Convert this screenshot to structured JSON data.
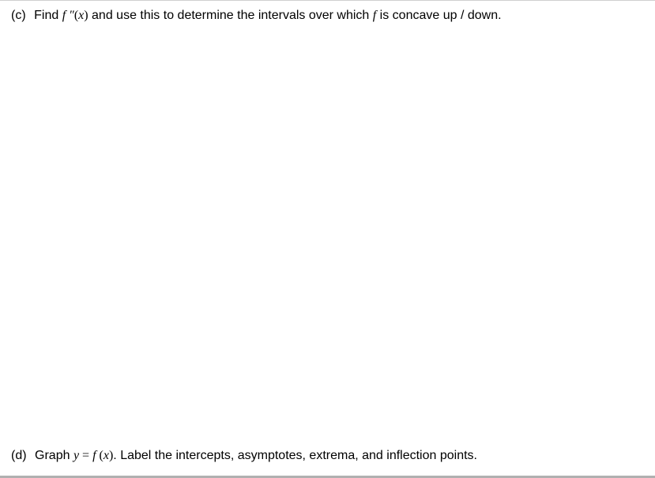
{
  "questions": {
    "c": {
      "label": "(c)",
      "pre_text": "Find ",
      "math": "f″(x)",
      "mid_text": " and use this to determine the intervals over which ",
      "math2": "f",
      "post_text": " is concave up / down."
    },
    "d": {
      "label": "(d)",
      "pre_text": "Graph ",
      "math": "y = f(x)",
      "post_text": ". Label the intercepts, asymptotes, extrema, and inflection points."
    }
  }
}
